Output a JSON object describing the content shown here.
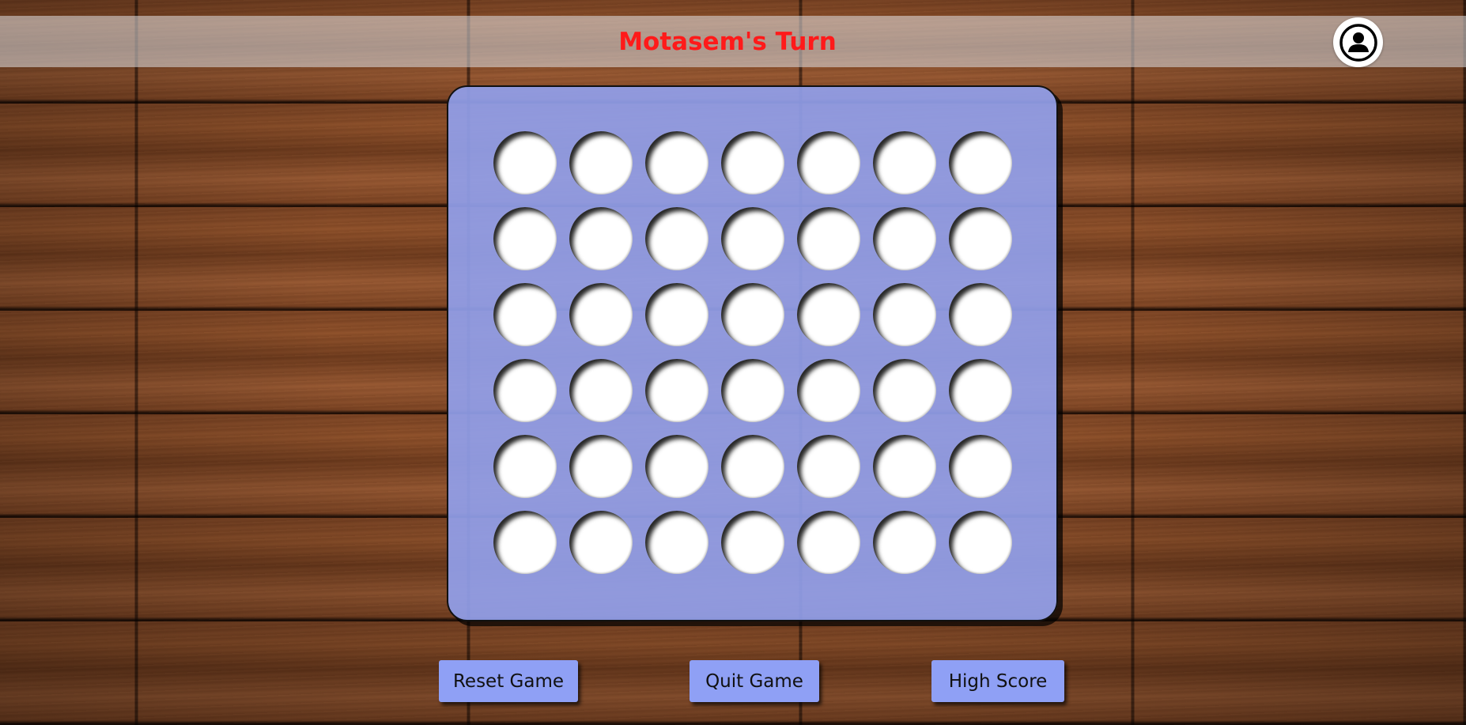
{
  "header": {
    "turn_text": "Motasem's Turn",
    "turn_color": "#ff1a1a",
    "profile_icon": "user-circle-icon"
  },
  "board": {
    "rows": 6,
    "columns": 7,
    "color": "#919fea",
    "cells": [
      [
        "empty",
        "empty",
        "empty",
        "empty",
        "empty",
        "empty",
        "empty"
      ],
      [
        "empty",
        "empty",
        "empty",
        "empty",
        "empty",
        "empty",
        "empty"
      ],
      [
        "empty",
        "empty",
        "empty",
        "empty",
        "empty",
        "empty",
        "empty"
      ],
      [
        "empty",
        "empty",
        "empty",
        "empty",
        "empty",
        "empty",
        "empty"
      ],
      [
        "empty",
        "empty",
        "empty",
        "empty",
        "empty",
        "empty",
        "empty"
      ],
      [
        "empty",
        "empty",
        "empty",
        "empty",
        "empty",
        "empty",
        "empty"
      ]
    ]
  },
  "buttons": {
    "reset_label": "Reset Game",
    "quit_label": "Quit Game",
    "high_score_label": "High Score",
    "color": "#8fa0f5"
  }
}
